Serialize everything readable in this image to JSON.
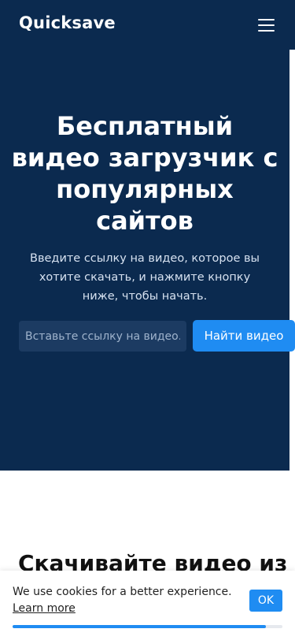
{
  "header": {
    "brand": "Quicksave",
    "menu_icon": "hamburger-menu-icon"
  },
  "hero": {
    "title": "Бесплатный видео загрузчик с популярных сайтов",
    "subtitle": "Введите ссылку на видео, которое вы хотите скачать, и нажмите кнопку ниже, чтобы начать.",
    "search_placeholder": "Вставьте ссылку на видео...",
    "search_value": "",
    "find_button": "Найти видео"
  },
  "section": {
    "heading": "Скачивайте видео из"
  },
  "cookie": {
    "text": "We use cookies for a better experience.",
    "learn_more": "Learn more",
    "period": ".",
    "ok": "OK"
  },
  "scroll": {
    "progress": 0.94
  },
  "colors": {
    "hero_bg": "#0b2a4f",
    "accent": "#1f8cf2"
  }
}
